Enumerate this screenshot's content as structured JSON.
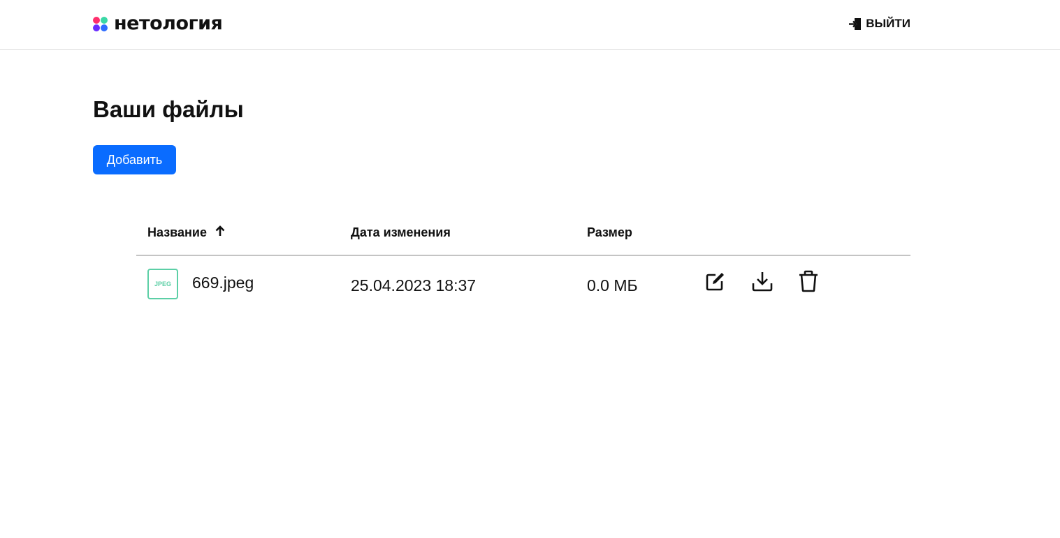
{
  "header": {
    "logo_text": "нетология",
    "logout_label": "ВЫЙТИ"
  },
  "main": {
    "title": "Ваши файлы",
    "add_button_label": "Добавить"
  },
  "table": {
    "columns": {
      "name": "Название",
      "date": "Дата изменения",
      "size": "Размер"
    },
    "sort": {
      "column": "name",
      "direction": "ascending"
    },
    "rows": [
      {
        "type_badge": "JPEG",
        "name": "669.jpeg",
        "modified": "25.04.2023 18:37",
        "size": "0.0 МБ",
        "actions": [
          "edit-icon",
          "download-icon",
          "trash-icon"
        ]
      }
    ]
  },
  "colors": {
    "accent": "#0a6cff",
    "jpeg_badge": "#5ccfa6",
    "logo": [
      "#ff2f6d",
      "#3ad8a6",
      "#6a2cff",
      "#2f6dff"
    ]
  }
}
